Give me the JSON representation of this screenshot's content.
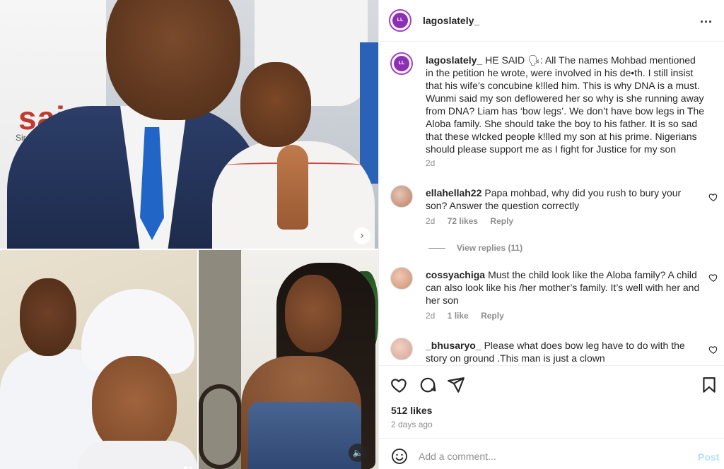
{
  "post": {
    "username": "lagoslately_",
    "avatar_text": "LL",
    "more_icon": "...",
    "media": {
      "top_sign_text": "sai",
      "top_sign_sub": "Sir Davy",
      "next_icon": "›",
      "sound_icon": "🔈",
      "carousel_dots": 2,
      "carousel_active": 0
    },
    "caption": {
      "username": "lagoslately_",
      "text": "HE SAID 🗣: All The names Mohbad mentioned in the petition he wrote, were involved in his de•th. I still insist that his wife’s concubine k!lled him. This is why DNA is a must. Wunmi said my son deflowered her so why is she running away from DNA? Liam has ‘bow legs’. We don’t have bow legs in The Aloba family. She should take the boy to his father. It is so sad that these w!cked people k!lled my son at his prime. Nigerians should please support me as I fight for Justice for my son",
      "time": "2d"
    },
    "comments": [
      {
        "username": "ellahellah22",
        "text": "Papa mohbad, why did you rush to bury your son? Answer the question correctly",
        "time": "2d",
        "likes": "72 likes",
        "reply": "Reply",
        "view_replies": "View replies (11)"
      },
      {
        "username": "cossyachiga",
        "text": "Must the child look like the Aloba family? A child can also look like his /her mother’s family. It’s well with her and her son",
        "time": "2d",
        "likes": "1 like",
        "reply": "Reply"
      },
      {
        "username": "_bhusaryo_",
        "text": "Please what does bow leg have to do with the story on ground .This man is just a clown"
      }
    ],
    "likes": "512 likes",
    "date": "2 days ago",
    "add_comment_placeholder": "Add a comment...",
    "post_label": "Post",
    "icons": [
      "heart-icon",
      "comment-icon",
      "share-icon",
      "bookmark-icon",
      "emoji-icon"
    ],
    "colors": {
      "brand_purple": "#8d2fb5",
      "post_button": "#b2dffc",
      "muted": "#8e8e8e"
    }
  }
}
